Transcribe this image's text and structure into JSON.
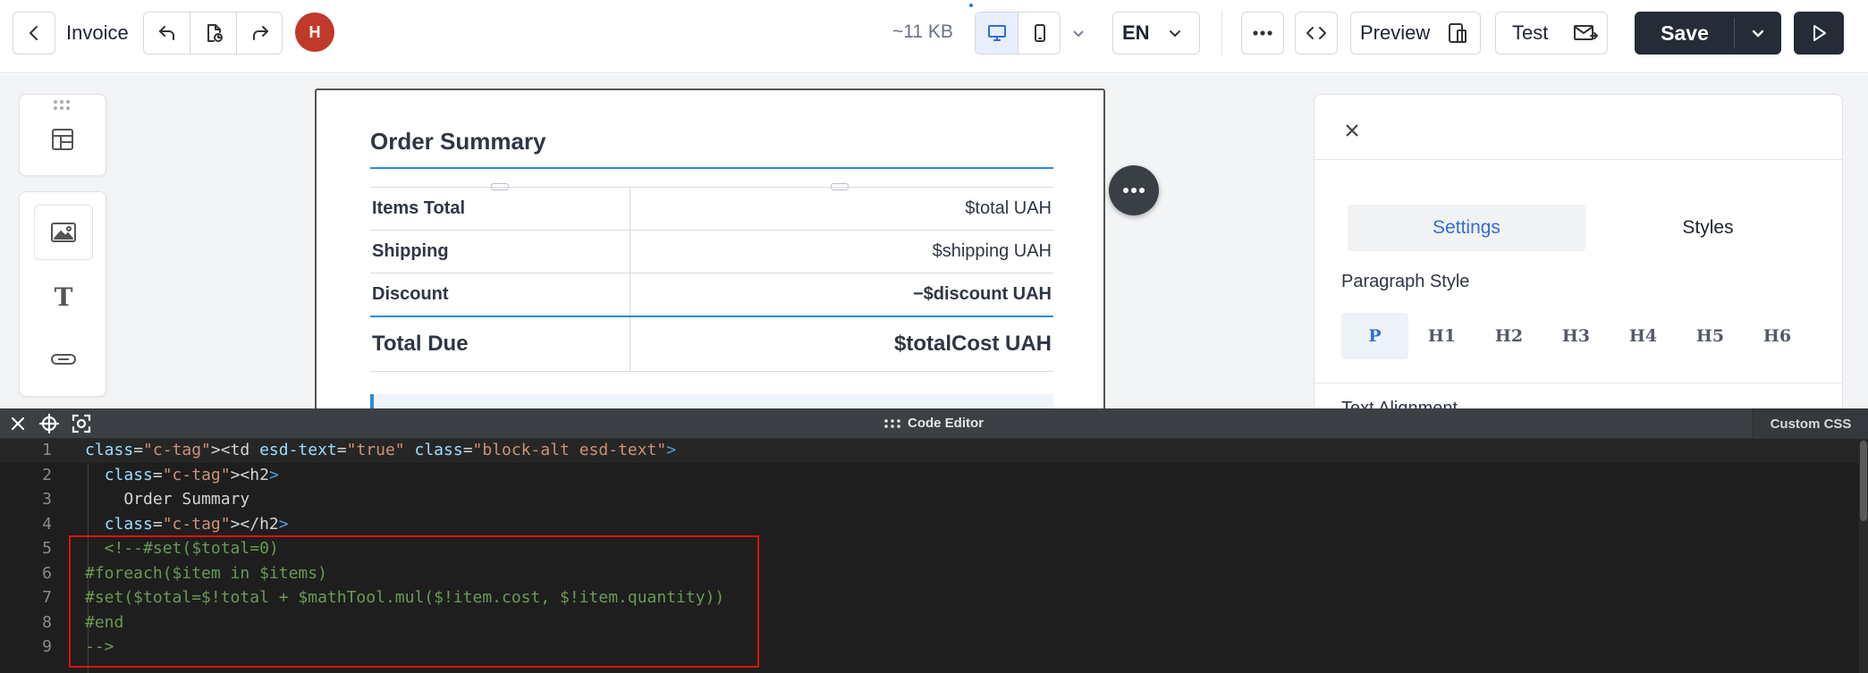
{
  "toolbar": {
    "title": "Invoice",
    "avatar_initial": "H",
    "size_label": "~11 KB",
    "language": "EN",
    "preview_label": "Preview",
    "test_label": "Test",
    "save_label": "Save",
    "avatar_color": "#c0392b",
    "active_device": "desktop"
  },
  "sidebar": {
    "blocks": [
      "structures-icon",
      "image-icon",
      "text-icon",
      "button-icon"
    ]
  },
  "email": {
    "heading": "Order Summary",
    "rows": [
      {
        "label": "Items Total",
        "value": "$total UAH"
      },
      {
        "label": "Shipping",
        "value": "$shipping UAH"
      },
      {
        "label": "Discount",
        "value": "−$discount UAH"
      }
    ],
    "total": {
      "label": "Total Due",
      "value": "$totalCost UAH"
    }
  },
  "panel": {
    "tabs": [
      "Settings",
      "Styles"
    ],
    "active_tab": "Settings",
    "paragraph_style_label": "Paragraph Style",
    "styles": [
      "P",
      "H1",
      "H2",
      "H3",
      "H4",
      "H5",
      "H6"
    ],
    "active_style": "P",
    "next_section_label": "Text Alignment"
  },
  "code_editor": {
    "title": "Code Editor",
    "custom_css_label": "Custom CSS",
    "lines": [
      {
        "n": "1",
        "text": "<td esd-text=\"true\" class=\"block-alt esd-text\">"
      },
      {
        "n": "2",
        "text": "  <h2>"
      },
      {
        "n": "3",
        "text": "    Order Summary"
      },
      {
        "n": "4",
        "text": "  </h2>"
      },
      {
        "n": "5",
        "text": "  <!--#set($total=0)"
      },
      {
        "n": "6",
        "text": "#foreach($item in $items)"
      },
      {
        "n": "7",
        "text": "#set($total=$!total + $mathTool.mul($!item.cost, $!item.quantity))"
      },
      {
        "n": "8",
        "text": "#end"
      },
      {
        "n": "9",
        "text": "-->"
      }
    ],
    "highlight_color": "#e01010"
  }
}
